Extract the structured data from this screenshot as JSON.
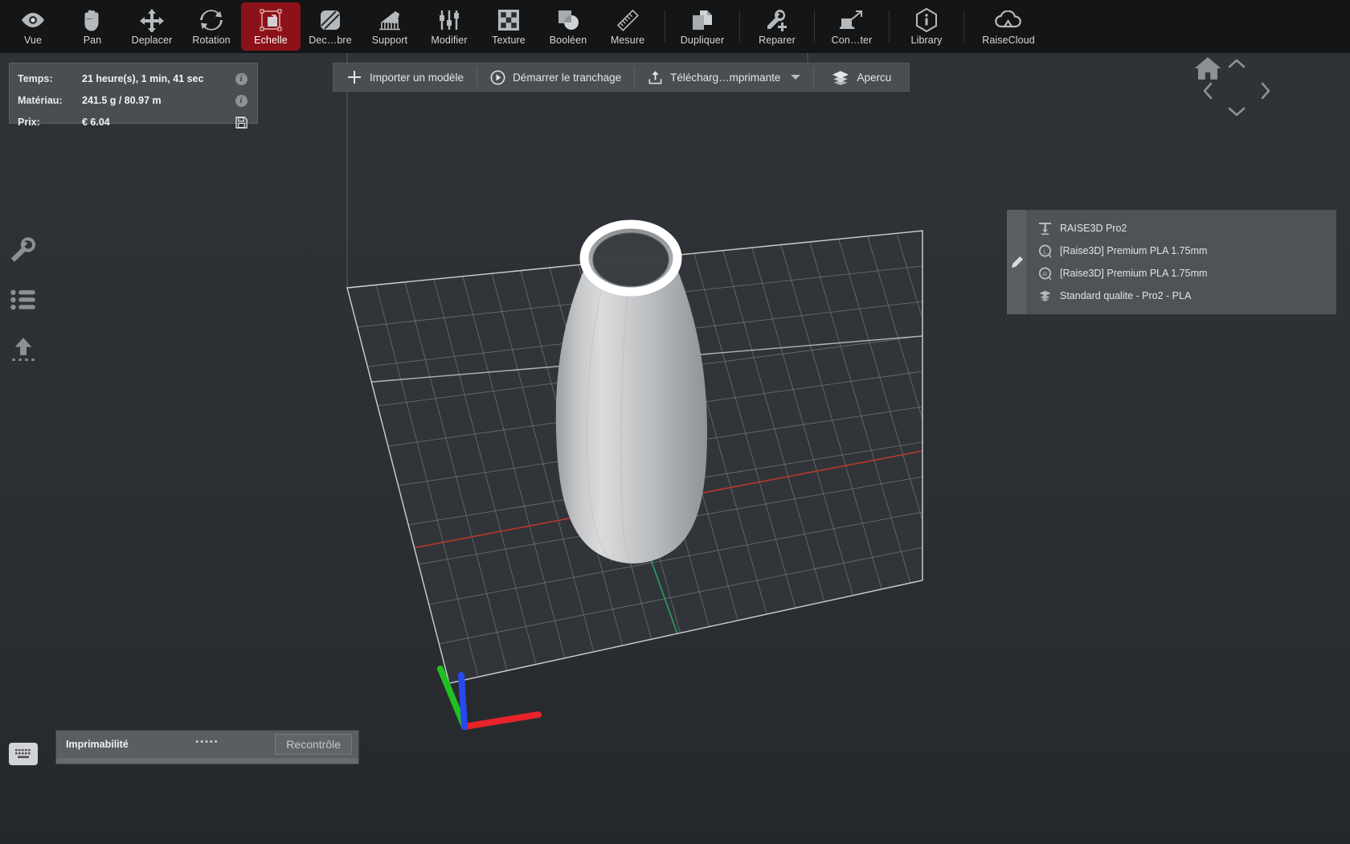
{
  "toolbar": {
    "items": [
      {
        "label": "Vue",
        "icon": "eye-icon",
        "active": false,
        "sep_after": false
      },
      {
        "label": "Pan",
        "icon": "hand-icon",
        "active": false,
        "sep_after": false
      },
      {
        "label": "Deplacer",
        "icon": "move-arrows-icon",
        "active": false,
        "sep_after": false
      },
      {
        "label": "Rotation",
        "icon": "rotate-icon",
        "active": false,
        "sep_after": false
      },
      {
        "label": "Echelle",
        "icon": "scale-icon",
        "active": true,
        "sep_after": false
      },
      {
        "label": "Dec…bre",
        "icon": "cut-plane-icon",
        "active": false,
        "sep_after": false
      },
      {
        "label": "Support",
        "icon": "support-icon",
        "active": false,
        "sep_after": false
      },
      {
        "label": "Modifier",
        "icon": "sliders-icon",
        "active": false,
        "sep_after": false
      },
      {
        "label": "Texture",
        "icon": "checkerboard-icon",
        "active": false,
        "sep_after": false
      },
      {
        "label": "Booléen",
        "icon": "boolean-icon",
        "active": false,
        "sep_after": false
      },
      {
        "label": "Mesure",
        "icon": "ruler-icon",
        "active": false,
        "sep_after": true
      },
      {
        "label": "Dupliquer",
        "icon": "duplicate-icon",
        "active": false,
        "sep_after": true
      },
      {
        "label": "Reparer",
        "icon": "wrench-plus-icon",
        "active": false,
        "sep_after": true
      },
      {
        "label": "Con…ter",
        "icon": "connect-icon",
        "active": false,
        "sep_after": true
      },
      {
        "label": "Library",
        "icon": "info-hex-icon",
        "active": false,
        "sep_after": true
      },
      {
        "label": "RaiseCloud",
        "icon": "cloud-icon",
        "active": false,
        "sep_after": false
      }
    ]
  },
  "info_panel": {
    "rows": [
      {
        "label": "Temps:",
        "value": "21 heure(s), 1 min, 41 sec",
        "action": "info-badge"
      },
      {
        "label": "Matériau:",
        "value": "241.5 g / 80.97 m",
        "action": "info-badge"
      },
      {
        "label": "Prix:",
        "value": "€ 6.04",
        "action": "save-icon"
      }
    ]
  },
  "left_rail": {
    "items": [
      {
        "icon": "wrench-icon",
        "name": "settings-tool"
      },
      {
        "icon": "list-icon",
        "name": "model-list-tool"
      },
      {
        "icon": "upload-icon",
        "name": "upload-tool"
      }
    ],
    "keyboard_button": {
      "icon": "keyboard-icon"
    }
  },
  "action_bar": {
    "import_label": "Importer un modèle",
    "slice_label": "Démarrer le tranchage",
    "upload_label": "Télécharg…mprimante",
    "preview_label": "Apercu"
  },
  "nav_controls": {
    "up": "chevron-up-icon",
    "down": "chevron-down-icon",
    "left": "chevron-left-icon",
    "right": "chevron-right-icon",
    "home": "home-icon"
  },
  "settings_panel": {
    "edit_tab_icon": "pencil-icon",
    "rows": [
      {
        "icon": "printer-icon",
        "text": "RAISE3D Pro2"
      },
      {
        "icon": "filament-left-icon",
        "text": "[Raise3D] Premium PLA 1.75mm"
      },
      {
        "icon": "filament-right-icon",
        "text": "[Raise3D] Premium PLA 1.75mm"
      },
      {
        "icon": "layers-icon",
        "text": "Standard qualite - Pro2 - PLA"
      }
    ]
  },
  "status_bar": {
    "label": "Imprimabilité",
    "dots": "•••••",
    "button_label": "Recontrôle"
  },
  "colors": {
    "accent_red": "#8b1218",
    "toolbar_bg": "#141516",
    "panel_bg": "#4f5356",
    "viewport_bg": "#2e3237",
    "axis_x": "#e02020",
    "axis_y": "#19b419",
    "axis_z": "#2244ee"
  }
}
